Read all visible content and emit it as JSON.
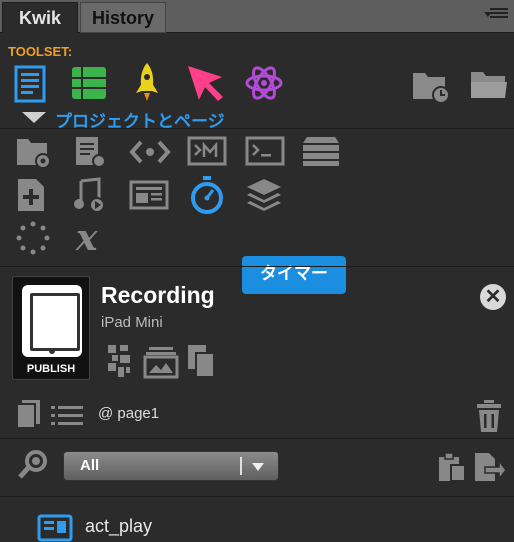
{
  "tabs": [
    {
      "label": "Kwik"
    },
    {
      "label": "History"
    }
  ],
  "toolset": {
    "label": "TOOLSET:",
    "icons": [
      "page-icon",
      "list-grid-icon",
      "rocket-icon",
      "cursor-arrow-icon",
      "atom-icon"
    ],
    "right_icons": [
      "folder-clock-icon",
      "folder-icon"
    ],
    "tooltip_project": "プロジェクトとページ"
  },
  "tools": {
    "row1": [
      "folder-gear-icon",
      "page-gear-icon",
      "code-icon",
      "terminal-m-icon",
      "terminal-icon",
      "stack-icon"
    ],
    "row2": [
      "add-page-icon",
      "music-icon",
      "newspaper-icon",
      "timer-icon",
      "layers-icon"
    ],
    "row3": [
      "dotted-circle-icon",
      "variable-x-icon"
    ],
    "tooltip_timer": "タイマー"
  },
  "project": {
    "title": "Recording",
    "device": "iPad Mini",
    "publish_label": "PUBLISH",
    "current_page": "@ page1"
  },
  "filter": {
    "selected": "All"
  },
  "items": [
    {
      "label": "act_play",
      "icon": "action-icon"
    }
  ],
  "colors": {
    "accent": "#1b8ee0",
    "toolset_label": "#f0a020",
    "rocket": "#e8d21c",
    "cursor": "#ff3f8a",
    "atom": "#b44ad8"
  }
}
